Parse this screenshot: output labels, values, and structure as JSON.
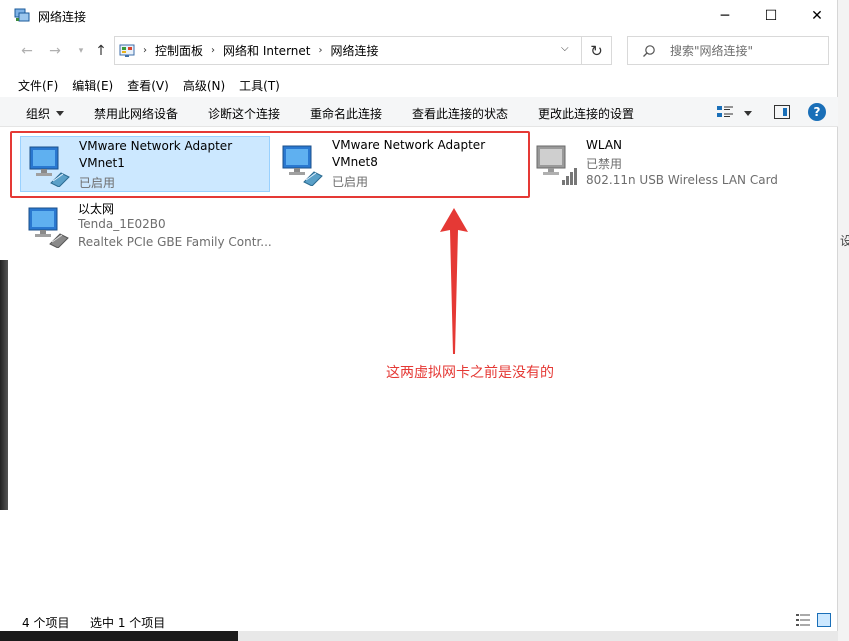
{
  "window": {
    "title": "网络连接",
    "controls": {
      "minimize": "─",
      "maximize": "☐",
      "close": "✕"
    }
  },
  "nav": {
    "back": "←",
    "forward": "→",
    "up": "↑",
    "breadcrumbs": [
      "控制面板",
      "网络和 Internet",
      "网络连接"
    ],
    "refresh": "↻",
    "search_placeholder": "搜索\"网络连接\""
  },
  "menu": [
    "文件(F)",
    "编辑(E)",
    "查看(V)",
    "高级(N)",
    "工具(T)"
  ],
  "commands": {
    "organize": "组织",
    "disable": "禁用此网络设备",
    "diagnose": "诊断这个连接",
    "rename": "重命名此连接",
    "status": "查看此连接的状态",
    "settings": "更改此连接的设置"
  },
  "help": "?",
  "adapters": [
    {
      "name": "VMware Network Adapter",
      "sub": "VMnet1",
      "status": "已启用",
      "selected": true
    },
    {
      "name": "VMware Network Adapter",
      "sub": "VMnet8",
      "status": "已启用",
      "selected": false
    },
    {
      "name": "WLAN",
      "sub": "已禁用",
      "status": "802.11n USB Wireless LAN Card",
      "selected": false
    },
    {
      "name": "以太网",
      "sub": "Tenda_1E02B0",
      "status": "Realtek PCIe GBE Family Contr...",
      "selected": false
    }
  ],
  "annotation": "这两虚拟网卡之前是没有的",
  "statusbar": {
    "count": "4 个项目",
    "selected": "选中 1 个项目"
  },
  "edge_glyph": "设",
  "colors": {
    "accent": "#1a6fb8",
    "selection": "#cce8ff",
    "annotation": "#e53935"
  }
}
